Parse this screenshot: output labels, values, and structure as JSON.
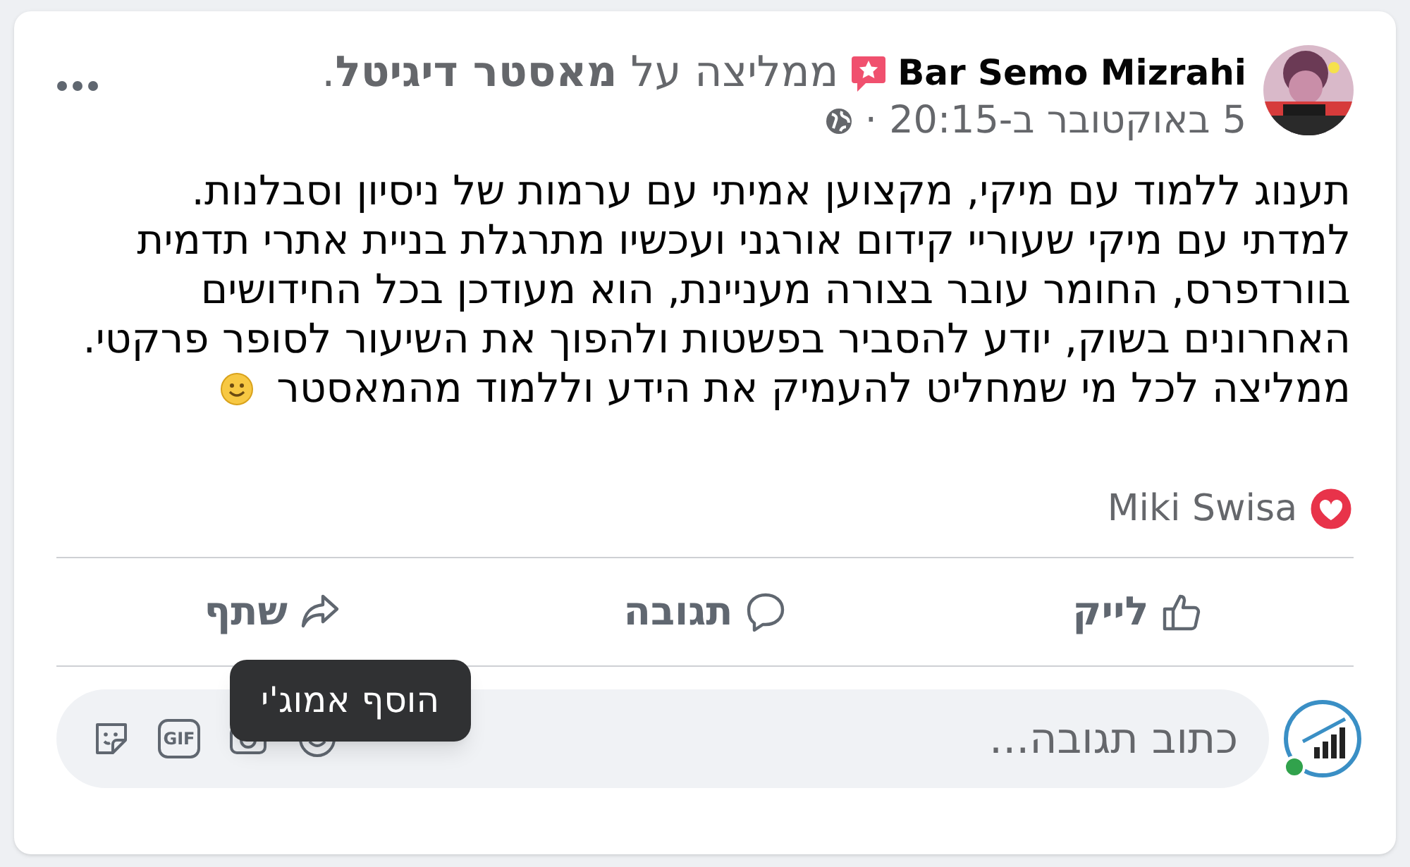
{
  "post": {
    "author": "Bar Semo Mizrahi",
    "recommendation": "ממליצה על **מאסטר דיגיטל**.",
    "timestamp": "5 באוקטובר ב-20:15 ·",
    "text": [
      "תענוג ללמוד עם מיקי, מקצוען אמיתי עם ערמות של ניסיון וסבלנות.",
      "למדתי עם מיקי שעוריי קידום אורגני ועכשיו מתרגלת בניית אתרי תדמית\nבוורדפרס, החומר עובר בצורה מעניינת, הוא מעודכן בכל החידושים\nהאחרונים בשוק, יודע להסביר בפשטות ולהפוך את השיעור לסופר פרקטי.",
      "ממליצה לכל מי שמחליט להעמיק את הידע וללמוד מהמאסטר"
    ],
    "reactions": {
      "kind": "love",
      "names": "Miki Swisa"
    }
  },
  "actions": [
    {
      "kind": "like",
      "label": "לייק"
    },
    {
      "kind": "comment",
      "label": "תגובה"
    },
    {
      "kind": "share",
      "label": "שתף"
    }
  ],
  "comment_box": {
    "placeholder": "כתוב תגובה...",
    "online": true,
    "tools": [
      {
        "kind": "emoji"
      },
      {
        "kind": "camera"
      },
      {
        "kind": "gif",
        "label": "GIF"
      },
      {
        "kind": "sticker"
      }
    ]
  },
  "tooltip": "הוסף אמוג'י"
}
